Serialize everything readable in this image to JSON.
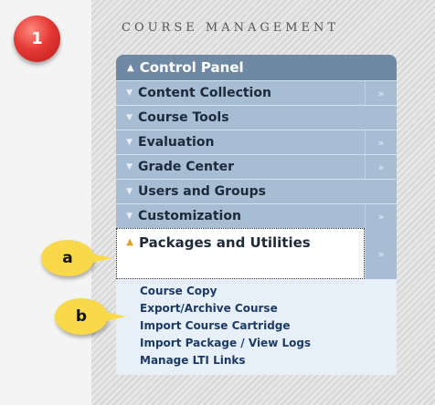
{
  "step_badge": "1",
  "section_title": "COURSE MANAGEMENT",
  "control_panel": {
    "header": "Control Panel",
    "items": [
      {
        "label": "Content Collection",
        "has_expand": true
      },
      {
        "label": "Course Tools",
        "has_expand": false
      },
      {
        "label": "Evaluation",
        "has_expand": true
      },
      {
        "label": "Grade Center",
        "has_expand": true
      },
      {
        "label": "Users and Groups",
        "has_expand": false
      },
      {
        "label": "Customization",
        "has_expand": true
      }
    ],
    "active_item": {
      "label": "Packages and Utilities"
    },
    "submenu": [
      "Course Copy",
      "Export/Archive Course",
      "Import Course Cartridge",
      "Import Package / View Logs",
      "Manage LTI Links"
    ]
  },
  "callouts": {
    "a": "a",
    "b": "b"
  },
  "icons": {
    "collapse": "chevron-up-icon",
    "expand": "chevron-down-icon",
    "flyout": "chevron-right-icon"
  }
}
